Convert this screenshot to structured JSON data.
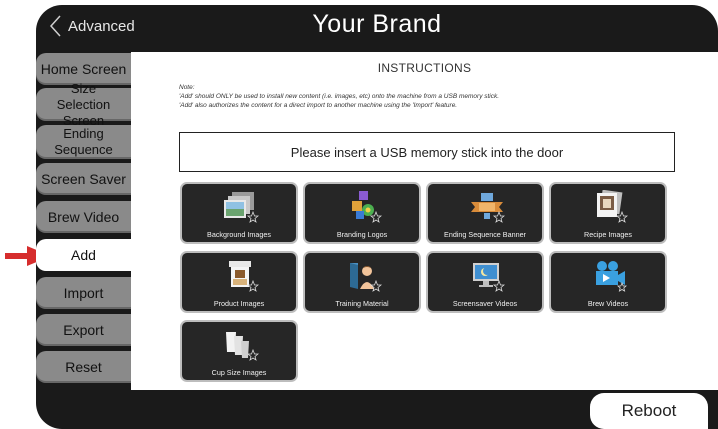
{
  "header": {
    "back_label": "Advanced",
    "title": "Your Brand"
  },
  "sidebar": {
    "items": [
      {
        "label": "Home Screen"
      },
      {
        "label": "Size Selection Screen"
      },
      {
        "label": "Ending Sequence"
      },
      {
        "label": "Screen Saver"
      },
      {
        "label": "Brew Video"
      },
      {
        "label": "Add",
        "active": true
      },
      {
        "label": "Import"
      },
      {
        "label": "Export"
      },
      {
        "label": "Reset"
      }
    ]
  },
  "instructions": {
    "title": "INSTRUCTIONS",
    "note_lines": [
      "Note:",
      "'Add' should ONLY be used to install new content (i.e. images, etc) onto the machine from a USB memory stick.",
      "'Add' also authorizes the content for a direct import to another machine using the 'Import' feature."
    ],
    "usb_message": "Please insert a USB memory stick into the door"
  },
  "tiles": [
    {
      "label": "Background Images",
      "icon": "image-stack-icon"
    },
    {
      "label": "Branding Logos",
      "icon": "logos-icon"
    },
    {
      "label": "Ending Sequence Banner",
      "icon": "banner-icon"
    },
    {
      "label": "Recipe Images",
      "icon": "recipe-photo-icon"
    },
    {
      "label": "Product Images",
      "icon": "product-icon"
    },
    {
      "label": "Training Material",
      "icon": "training-icon"
    },
    {
      "label": "Screensaver Videos",
      "icon": "screensaver-icon"
    },
    {
      "label": "Brew Videos",
      "icon": "video-camera-icon"
    },
    {
      "label": "Cup Size Images",
      "icon": "cups-icon"
    }
  ],
  "footer": {
    "reboot_label": "Reboot"
  },
  "colors": {
    "accent_arrow": "#d62d2d",
    "tab": "#8a8a8a",
    "tile_bg": "#262626"
  }
}
